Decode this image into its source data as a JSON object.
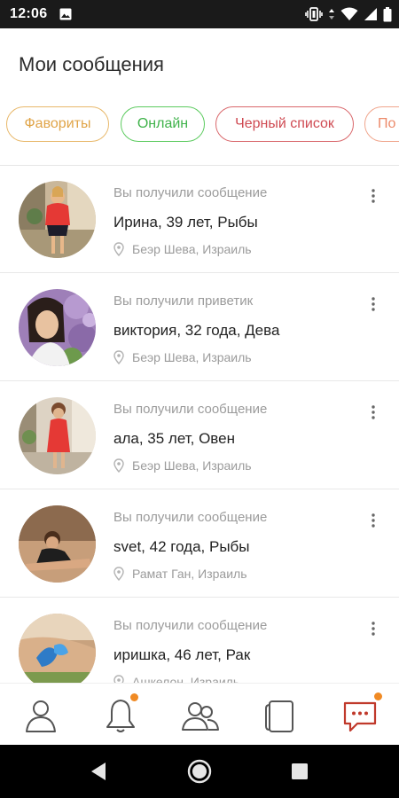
{
  "status_bar": {
    "time": "12:06",
    "icons": [
      "image-icon",
      "vibrate-icon",
      "data-arrows-icon",
      "wifi-icon",
      "signal-icon",
      "battery-icon"
    ]
  },
  "header": {
    "title": "Мои сообщения"
  },
  "filters": [
    {
      "label": "Фавориты",
      "color": "#e0a447"
    },
    {
      "label": "Онлайн",
      "color": "#3fb24a"
    },
    {
      "label": "Черный список",
      "color": "#cf4a52"
    },
    {
      "label": "По",
      "color": "#ec8a6a"
    }
  ],
  "messages": [
    {
      "status": "Вы получили сообщение",
      "name": "Ирина, 39 лет, Рыбы",
      "location": "Беэр Шева, Израиль"
    },
    {
      "status": "Вы получили приветик",
      "name": "виктория, 32 года, Дева",
      "location": "Беэр Шева, Израиль"
    },
    {
      "status": "Вы получили сообщение",
      "name": "ала, 35 лет, Овен",
      "location": "Беэр Шева, Израиль"
    },
    {
      "status": "Вы получили сообщение",
      "name": "svet, 42 года, Рыбы",
      "location": "Рамат Ган, Израиль"
    },
    {
      "status": "Вы получили сообщение",
      "name": "иришка, 46 лет, Рак",
      "location": "Ашкелон, Израиль"
    }
  ],
  "bottom_nav": {
    "items": [
      "profile-icon",
      "bell-icon",
      "people-icon",
      "cards-icon",
      "messages-icon"
    ],
    "active": "messages-icon",
    "accent_color": "#c0392b",
    "badge_color": "#f08a24"
  },
  "colors": {
    "text_primary": "#222222",
    "text_secondary": "#9b9b9b"
  }
}
